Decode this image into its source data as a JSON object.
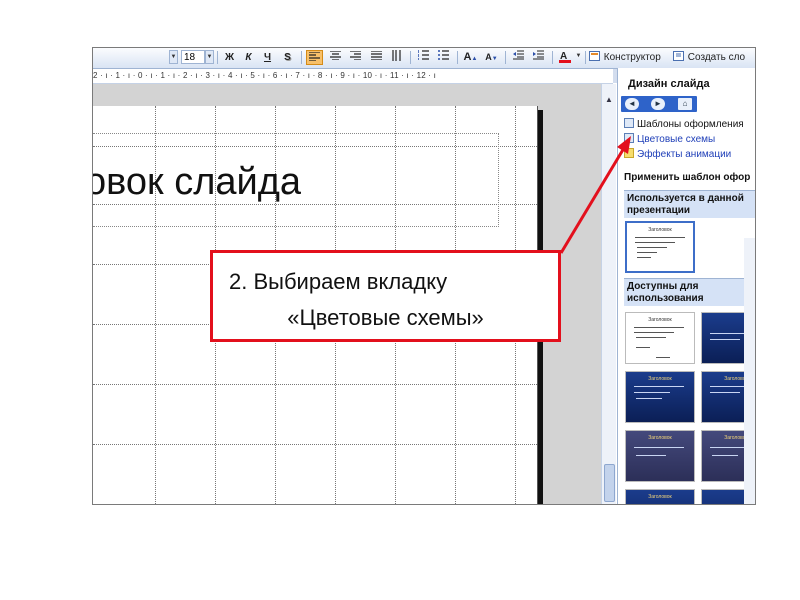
{
  "toolbar": {
    "font_size": "18",
    "bold": "Ж",
    "italic": "К",
    "underline": "Ч",
    "shadow": "S",
    "font_grow": "A",
    "font_shrink": "A",
    "constructor_label": "Конструктор",
    "new_slide_label": "Создать сло"
  },
  "ruler": {
    "text": "2 · ı · 1 · ı · 0 · ı · 1 · ı · 2 · ı · 3 · ı · 4 · ı · 5 · ı · 6 · ı · 7 · ı · 8 · ı · 9 · ı · 10 · ı · 11 · ı · 12 · ı"
  },
  "slide": {
    "title_text": "овок слайда"
  },
  "task_pane": {
    "title": "Дизайн слайда",
    "links": {
      "templates": "Шаблоны оформления",
      "color_schemes": "Цветовые схемы",
      "animation_effects": "Эффекты анимации"
    },
    "apply_heading": "Применить шаблон офор",
    "used_section": "Используется в данной презентации",
    "available_section": "Доступны для использования",
    "thumb_title": "Заголовок"
  },
  "callout": {
    "line1": "2. Выбираем вкладку",
    "line2": "«Цветовые схемы»",
    "border_color": "#e3101d"
  },
  "colors": {
    "pane_nav": "#2e63c9",
    "toolbar_bg": "#d9e4f4",
    "link_blue": "#1f3fb8"
  }
}
